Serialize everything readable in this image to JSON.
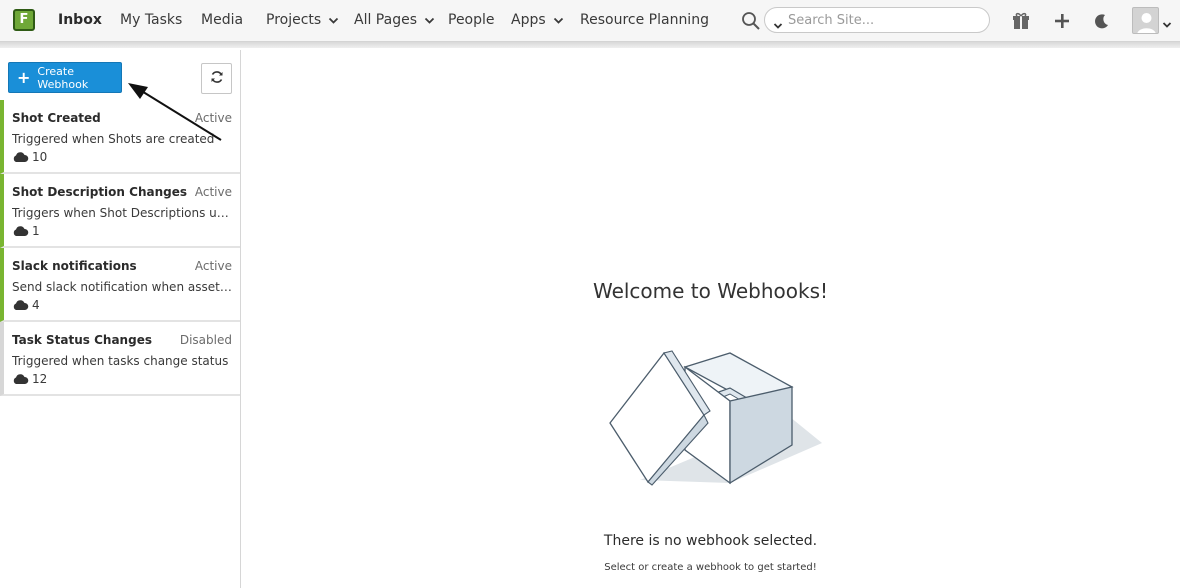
{
  "nav": {
    "logo_letter": "F",
    "items": [
      {
        "label": "Inbox"
      },
      {
        "label": "My Tasks"
      },
      {
        "label": "Media"
      },
      {
        "label": "Projects"
      },
      {
        "label": "All Pages"
      },
      {
        "label": "People"
      },
      {
        "label": "Apps"
      },
      {
        "label": "Resource Planning"
      }
    ],
    "search_placeholder": "Search Site...",
    "icons": [
      "search-icon",
      "gift-icon",
      "plus-icon",
      "moon-icon",
      "avatar",
      "chevron-down-icon"
    ]
  },
  "sidebar": {
    "create_label": "Create Webhook",
    "webhooks": [
      {
        "name": "Shot Created",
        "status": "Active",
        "description": "Triggered when Shots are created",
        "count": "10"
      },
      {
        "name": "Shot Description Changes",
        "status": "Active",
        "description": "Triggers when Shot Descriptions updated",
        "count": "1"
      },
      {
        "name": "Slack notifications",
        "status": "Active",
        "description": "Send slack notification when asset is updated",
        "count": "4"
      },
      {
        "name": "Task Status Changes",
        "status": "Disabled",
        "description": "Triggered when tasks change status",
        "count": "12"
      }
    ]
  },
  "main": {
    "welcome": "Welcome to Webhooks!",
    "empty_title": "There is no webhook selected.",
    "empty_subtitle": "Select or create a webhook to get started!"
  },
  "colors": {
    "accent": "#1a8fd8",
    "active_status": "#79b531",
    "disabled_status": "#d7d7d7",
    "logo": "#6fa838"
  }
}
